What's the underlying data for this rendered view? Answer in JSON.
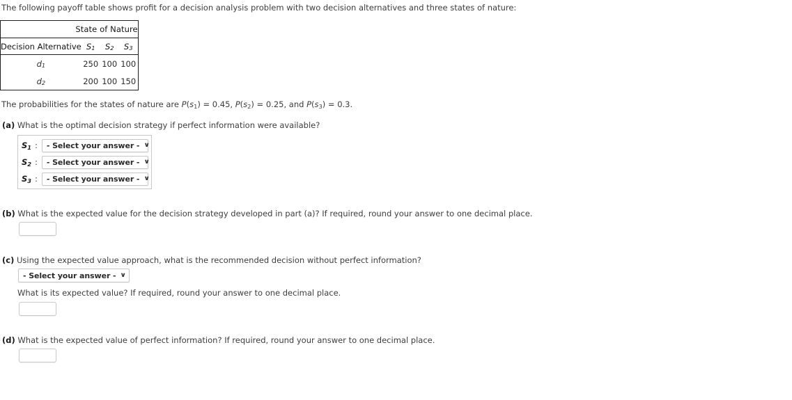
{
  "intro": "The following payoff table shows profit for a decision analysis problem with two decision alternatives and three states of nature:",
  "table": {
    "group_header": "State of Nature",
    "row_header_label": "Decision Alternative",
    "column_headers": [
      "S1",
      "S2",
      "S3"
    ],
    "column_header_bases": [
      "S",
      "S",
      "S"
    ],
    "column_header_subs": [
      "1",
      "2",
      "3"
    ],
    "rows": [
      {
        "alt_base": "d",
        "alt_sub": "1",
        "label": "d1",
        "values": [
          "250",
          "100",
          "100"
        ]
      },
      {
        "alt_base": "d",
        "alt_sub": "2",
        "label": "d2",
        "values": [
          "200",
          "100",
          "150"
        ]
      }
    ]
  },
  "probabilities": {
    "lead": "The probabilities for the states of nature are ",
    "p1_fn": "P",
    "p1_arg_base": "s",
    "p1_arg_sub": "1",
    "p1_eq": " = 0.45, ",
    "p2_fn": "P",
    "p2_arg_base": "s",
    "p2_arg_sub": "2",
    "p2_eq": " = 0.25, and ",
    "p3_fn": "P",
    "p3_arg_base": "s",
    "p3_arg_sub": "3",
    "p3_eq": " = 0.3.",
    "full_text": "The probabilities for the states of nature are P(s1) = 0.45, P(s2) = 0.25, and P(s3) = 0.3."
  },
  "questions": {
    "a": {
      "marker": "(a)",
      "text": " What is the optimal decision strategy if perfect information were available?",
      "rows": [
        {
          "label_base": "S",
          "label_sub": "1",
          "colon": ":",
          "select_value": "- Select your answer -"
        },
        {
          "label_base": "S",
          "label_sub": "2",
          "colon": ":",
          "select_value": "- Select your answer -"
        },
        {
          "label_base": "S",
          "label_sub": "3",
          "colon": ":",
          "select_value": "- Select your answer -"
        }
      ]
    },
    "b": {
      "marker": "(b)",
      "text": " What is the expected value for the decision strategy developed in part (a)? If required, round your answer to one decimal place.",
      "input_value": "",
      "input_placeholder": ""
    },
    "c": {
      "marker": "(c)",
      "text": " Using the expected value approach, what is the recommended decision without perfect information?",
      "select_value": "- Select your answer -",
      "followup_text": "What is its expected value? If required, round your answer to one decimal place.",
      "input_value": "",
      "input_placeholder": ""
    },
    "d": {
      "marker": "(d)",
      "text": " What is the expected value of perfect information? If required, round your answer to one decimal place.",
      "input_value": "",
      "input_placeholder": ""
    }
  },
  "icons": {
    "chevron_down": "∨"
  },
  "colors": {
    "text": "#3d3d3d",
    "strong_text": "#1a1a1a",
    "table_border": "#1d1d1d",
    "control_border": "#c6c6c6",
    "background": "#ffffff"
  }
}
